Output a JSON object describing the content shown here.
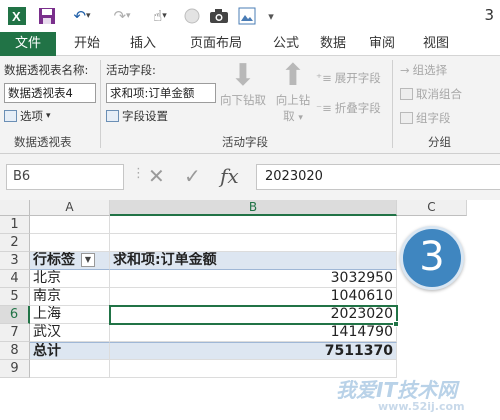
{
  "qat": {
    "save_icon": "save-icon",
    "undo_icon": "undo-icon",
    "redo_icon": "redo-icon",
    "touch_icon": "touch-mode-icon",
    "camera_icon": "camera-icon",
    "corner_text": "3"
  },
  "tabs": [
    {
      "label": "文件",
      "active": true
    },
    {
      "label": "开始"
    },
    {
      "label": "插入"
    },
    {
      "label": "页面布局"
    },
    {
      "label": "公式"
    },
    {
      "label": "数据"
    },
    {
      "label": "审阅"
    },
    {
      "label": "视图"
    }
  ],
  "ribbon": {
    "pivot_name_label": "数据透视表名称:",
    "pivot_name_value": "数据透视表4",
    "options_label": "选项",
    "group1_caption": "数据透视表",
    "active_field_label": "活动字段:",
    "active_field_value": "求和项:订单金额",
    "field_settings_label": "字段设置",
    "drill_down_label": "向下钻取",
    "drill_up_label": "向上钻",
    "drill_up_label2": "取",
    "expand_field_label": "展开字段",
    "collapse_field_label": "折叠字段",
    "group2_caption": "活动字段",
    "group_selection_label": "组选择",
    "ungroup_label": "取消组合",
    "group_field_label": "组字段",
    "group3_caption": "分组"
  },
  "formula_bar": {
    "name_box": "B6",
    "cancel_icon": "✕",
    "enter_icon": "✓",
    "fx_icon": "fx",
    "formula_value": "2023020"
  },
  "sheet": {
    "columns": [
      "A",
      "B",
      "C"
    ],
    "selected_column": "B",
    "rows": [
      "1",
      "2",
      "3",
      "4",
      "5",
      "6",
      "7",
      "8",
      "9"
    ],
    "selected_row": "6",
    "header_row_label": "行标签",
    "header_value_label": "求和项:订单金额",
    "data": [
      {
        "label": "北京",
        "value": "3032950"
      },
      {
        "label": "南京",
        "value": "1040610"
      },
      {
        "label": "上海",
        "value": "2023020"
      },
      {
        "label": "武汉",
        "value": "1414790"
      }
    ],
    "total_label": "总计",
    "total_value": "7511370"
  },
  "step_badge": "3",
  "watermark": {
    "line1": "我爱IT技术网",
    "line2": "www.52ij.com"
  }
}
